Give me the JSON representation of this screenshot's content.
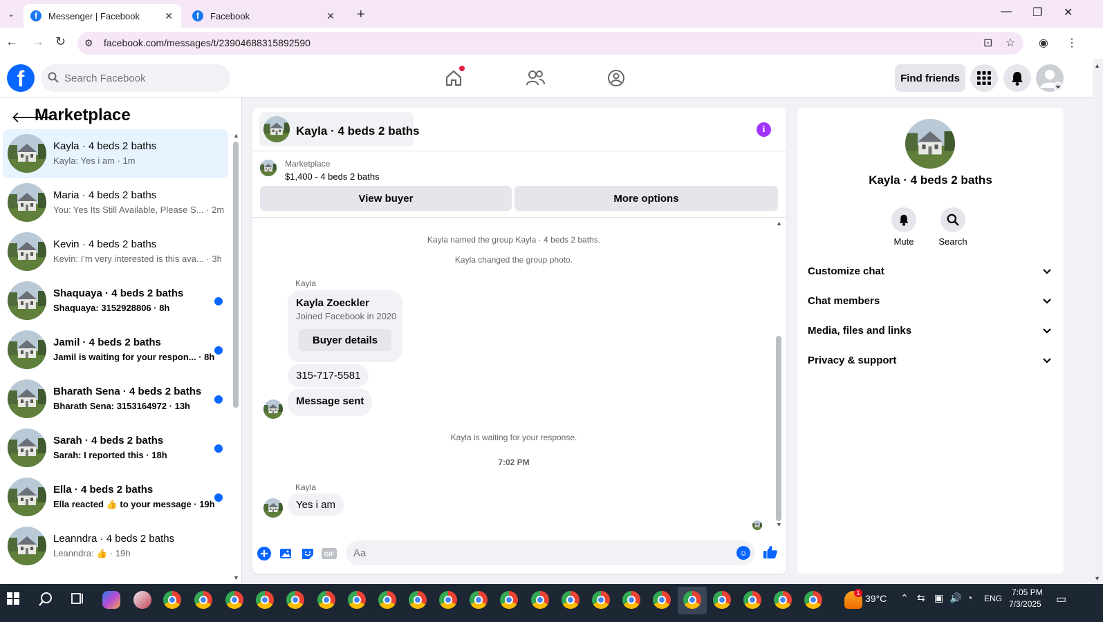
{
  "browser": {
    "tabs": [
      {
        "title": "Messenger | Facebook",
        "active": true
      },
      {
        "title": "Facebook",
        "active": false
      }
    ],
    "url": "facebook.com/messages/t/23904688315892590"
  },
  "header": {
    "search_placeholder": "Search Facebook",
    "find_friends": "Find friends"
  },
  "sidebar": {
    "title": "Marketplace",
    "conversations": [
      {
        "name": "Kayla · 4 beds 2 baths",
        "snippet": "Kayla: Yes i am · 1m",
        "active": true,
        "unread": false
      },
      {
        "name": "Maria · 4 beds 2 baths",
        "snippet": "You: Yes Its Still Available, Please S... · 2m",
        "active": false,
        "unread": false
      },
      {
        "name": "Kevin · 4 beds 2 baths",
        "snippet": "Kevin: I'm very interested is this ava... · 3h",
        "active": false,
        "unread": false
      },
      {
        "name": "Shaquaya · 4 beds 2 baths",
        "snippet": "Shaquaya: 3152928806 · 8h",
        "active": false,
        "unread": true
      },
      {
        "name": "Jamil · 4 beds 2 baths",
        "snippet": "Jamil is waiting for your respon... · 8h",
        "active": false,
        "unread": true
      },
      {
        "name": "Bharath Sena · 4 beds 2 baths",
        "snippet": "Bharath Sena: 3153164972 · 13h",
        "active": false,
        "unread": true
      },
      {
        "name": "Sarah · 4 beds 2 baths",
        "snippet": "Sarah: I reported this · 18h",
        "active": false,
        "unread": true
      },
      {
        "name": "Ella · 4 beds 2 baths",
        "snippet": "Ella reacted 👍 to your message · 19h",
        "active": false,
        "unread": true
      },
      {
        "name": "Leanndra · 4 beds 2 baths",
        "snippet": "Leanndra: 👍 · 19h",
        "active": false,
        "unread": false
      }
    ]
  },
  "chat": {
    "title": "Kayla · 4 beds 2 baths",
    "marketplace_label": "Marketplace",
    "listing": "$1,400 - 4 beds 2 baths",
    "view_buyer": "View buyer",
    "more_options": "More options",
    "sys_named": "Kayla named the group Kayla · 4 beds 2 baths.",
    "sys_photo": "Kayla changed the group photo.",
    "sender": "Kayla",
    "card_name": "Kayla Zoeckler",
    "card_joined": "Joined Facebook in 2020",
    "card_button": "Buyer details",
    "msg_phone": "315-717-5581",
    "msg_sent": "Message sent",
    "sys_waiting": "Kayla is waiting for your response.",
    "timestamp": "7:02 PM",
    "msg_last": "Yes i am",
    "composer_placeholder": "Aa"
  },
  "info_panel": {
    "title": "Kayla · 4 beds 2 baths",
    "mute": "Mute",
    "search": "Search",
    "sections": [
      "Customize chat",
      "Chat members",
      "Media, files and links",
      "Privacy & support"
    ]
  },
  "taskbar": {
    "weather": "39°C",
    "weather_badge": "1",
    "lang": "ENG",
    "time": "7:05 PM",
    "date": "7/3/2025"
  },
  "colors": {
    "fb_blue": "#0866ff",
    "info_purple": "#a033ff",
    "active_row": "#e7f3ff"
  }
}
